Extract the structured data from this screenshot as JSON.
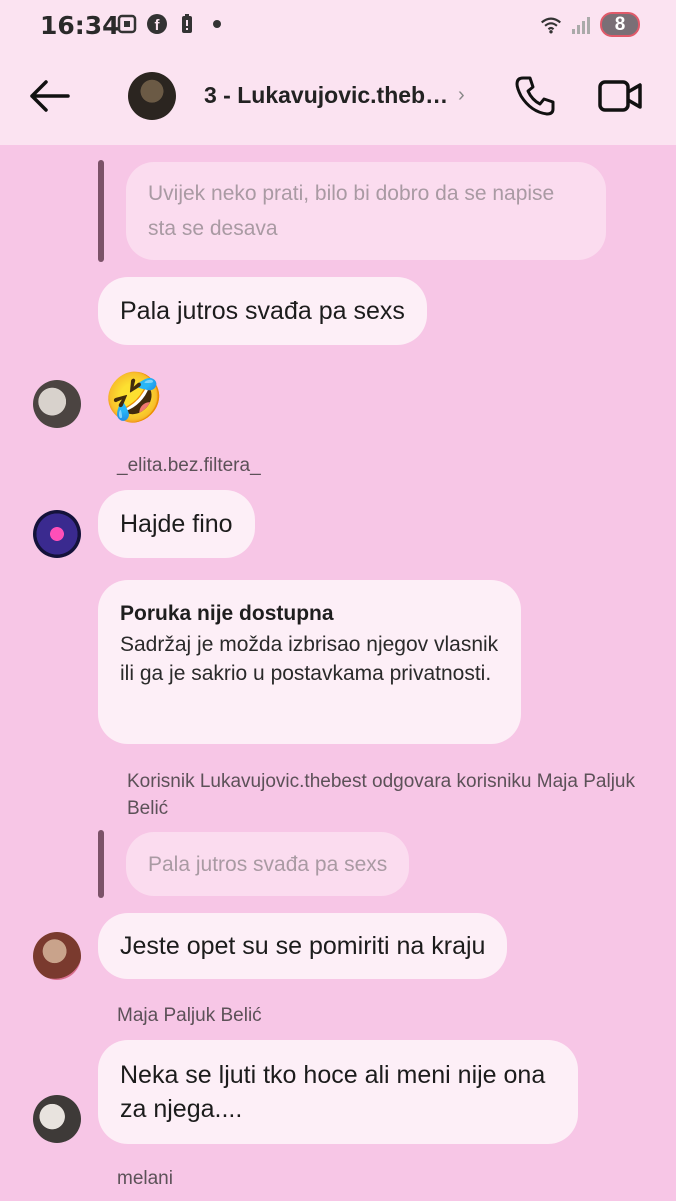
{
  "status_bar": {
    "time": "16:34",
    "battery": "8",
    "icons": [
      "screenshot-icon",
      "facebook-icon",
      "battery-saver-icon",
      "dot-icon",
      "wifi-icon",
      "signal-icon"
    ]
  },
  "header": {
    "title": "3 - Lukavujovic.theb…",
    "chevron": "›"
  },
  "messages": {
    "quoted1": "Uvijek neko prati, bilo bi dobro da se napise sta se desava",
    "m1": "Pala jutros svađa pa sexs",
    "m2_emoji": "🤣",
    "sender2": "_elita.bez.filtera_",
    "m3": "Hajde fino",
    "notice_title": "Poruka nije dostupna",
    "notice_body": "Sadržaj je možda izbrisao njegov vlasnik ili ga je sakrio u postavkama privatnosti.",
    "reply_note": "Korisnik Lukavujovic.thebest odgovara korisniku Maja Paljuk Belić",
    "quoted2": "Pala jutros svađa pa sexs",
    "m4": "Jeste opet su se pomiriti na kraju",
    "sender3": "Maja Paljuk Belić",
    "m5": "Neka se ljuti tko hoce ali meni nije ona za njega....",
    "sender4": "melani"
  },
  "colors": {
    "background": "#f7c6e6",
    "header": "#fbe3f1",
    "bubble": "#fdeff7",
    "quoted_bubble": "#fbdcef",
    "reply_bar": "#7b5268"
  }
}
